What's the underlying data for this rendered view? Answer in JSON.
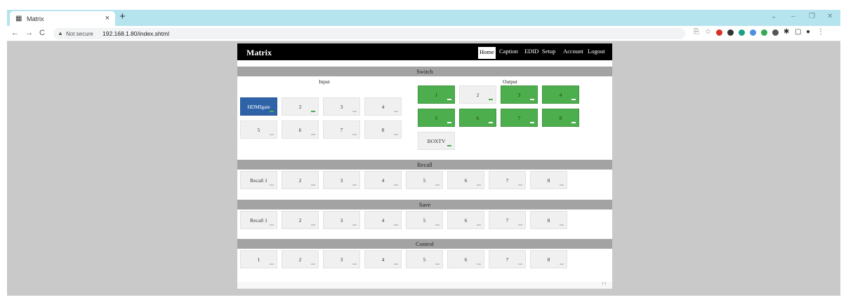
{
  "browser": {
    "tab_title": "Matrix",
    "tab_close": "×",
    "new_tab": "+",
    "window_controls": [
      "⌄",
      "–",
      "❐",
      "✕"
    ],
    "nav": {
      "back": "←",
      "forward": "→",
      "reload": "C"
    },
    "security_label": "Not secure",
    "url": "192.168.1.80/index.shtml",
    "extensions": [
      {
        "name": "translate-icon",
        "glyph": "⎘",
        "color": "#777777"
      },
      {
        "name": "star-icon",
        "glyph": "☆",
        "color": "#777777"
      },
      {
        "name": "ext-red-icon",
        "glyph": "",
        "color": "#d93025"
      },
      {
        "name": "ext-dark-icon",
        "glyph": "",
        "color": "#333333"
      },
      {
        "name": "ext-teal-icon",
        "glyph": "",
        "color": "#1aa085"
      },
      {
        "name": "ext-blue-icon",
        "glyph": "",
        "color": "#4a8fe8"
      },
      {
        "name": "ext-green-icon",
        "glyph": "",
        "color": "#34a853"
      },
      {
        "name": "ext-gray-icon",
        "glyph": "",
        "color": "#555555"
      },
      {
        "name": "puzzle-icon",
        "glyph": "✱",
        "color": "#333333"
      },
      {
        "name": "sidepanel-icon",
        "glyph": "▢",
        "color": "#333333"
      },
      {
        "name": "profile-icon",
        "glyph": "●",
        "color": "#333333"
      },
      {
        "name": "menu-icon",
        "glyph": "⋮",
        "color": "#333333"
      }
    ]
  },
  "app": {
    "brand": "Matrix",
    "nav": [
      {
        "label": "Home",
        "active": true
      },
      {
        "label": "Caption",
        "active": false
      },
      {
        "label": "EDID",
        "active": false
      },
      {
        "label": "Setup",
        "active": false
      },
      {
        "label": "Account",
        "active": false
      },
      {
        "label": "Logout",
        "active": false
      }
    ],
    "switch": {
      "title": "Switch",
      "input_label": "Input",
      "output_label": "Output",
      "inputs": [
        {
          "label": "HDMIgate",
          "state": "selected",
          "mark": "on"
        },
        {
          "label": "2",
          "state": "normal",
          "mark": "on"
        },
        {
          "label": "3",
          "state": "normal",
          "mark": "off"
        },
        {
          "label": "4",
          "state": "normal",
          "mark": "off"
        },
        {
          "label": "5",
          "state": "normal",
          "mark": "off"
        },
        {
          "label": "6",
          "state": "normal",
          "mark": "off"
        },
        {
          "label": "7",
          "state": "normal",
          "mark": "off"
        },
        {
          "label": "8",
          "state": "normal",
          "mark": "off"
        }
      ],
      "outputs": [
        {
          "label": "1",
          "state": "active",
          "mark": "off"
        },
        {
          "label": "2",
          "state": "normal",
          "mark": "on"
        },
        {
          "label": "3",
          "state": "active",
          "mark": "off"
        },
        {
          "label": "4",
          "state": "active",
          "mark": "off"
        },
        {
          "label": "5",
          "state": "active",
          "mark": "on"
        },
        {
          "label": "6",
          "state": "active",
          "mark": "on"
        },
        {
          "label": "7",
          "state": "active",
          "mark": "on"
        },
        {
          "label": "8",
          "state": "active",
          "mark": "on"
        },
        {
          "label": "BOXTV",
          "state": "normal",
          "mark": "on"
        }
      ]
    },
    "recall": {
      "title": "Recall",
      "buttons": [
        "Recall 1",
        "2",
        "3",
        "4",
        "5",
        "6",
        "7",
        "8"
      ]
    },
    "save": {
      "title": "Save",
      "buttons": [
        "Recall 1",
        "2",
        "3",
        "4",
        "5",
        "6",
        "7",
        "8"
      ]
    },
    "control": {
      "title": "Control",
      "buttons": [
        "1",
        "2",
        "3",
        "4",
        "5",
        "6",
        "7",
        "8"
      ]
    },
    "footer": {
      "arrow": "↑↑"
    }
  }
}
